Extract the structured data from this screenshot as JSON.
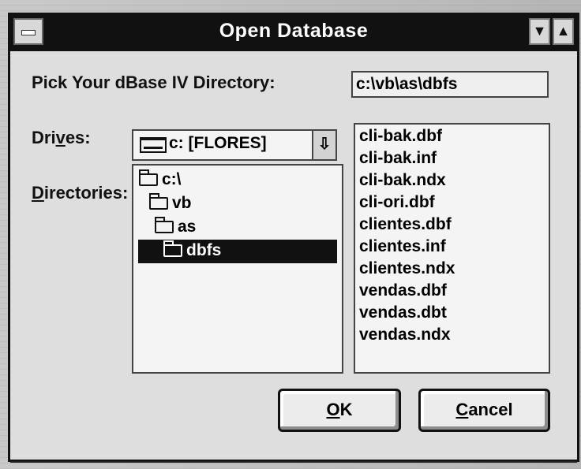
{
  "window": {
    "title": "Open Database"
  },
  "labels": {
    "pick_directory": "Pick Your dBase IV Directory:",
    "drives_prefix": "Dri",
    "drives_mnemonic": "v",
    "drives_suffix": "es:",
    "directories_mnemonic": "D",
    "directories_suffix": "irectories:"
  },
  "current_directory": "c:\\vb\\as\\dbfs",
  "drives": {
    "selected": "c: [FLORES]",
    "icon": "drive-icon",
    "dropdown_icon": "down-arrow-icon"
  },
  "directories": [
    {
      "name": "c:\\",
      "icon": "folder-open-icon"
    },
    {
      "name": "vb",
      "icon": "folder-open-icon"
    },
    {
      "name": "as",
      "icon": "folder-open-icon"
    },
    {
      "name": "dbfs",
      "icon": "folder-open-icon",
      "selected": true
    }
  ],
  "files": [
    "cli-bak.dbf",
    "cli-bak.inf",
    "cli-bak.ndx",
    "cli-ori.dbf",
    "clientes.dbf",
    "clientes.inf",
    "clientes.ndx",
    "vendas.dbf",
    "vendas.dbt",
    "vendas.ndx"
  ],
  "buttons": {
    "ok_mnemonic": "O",
    "ok_suffix": "K",
    "cancel_mnemonic": "C",
    "cancel_suffix": "ancel"
  },
  "colors": {
    "title_bar": "#111111",
    "dialog_face": "#dedede",
    "list_background": "#f4f4f4",
    "selection": "#111111"
  }
}
